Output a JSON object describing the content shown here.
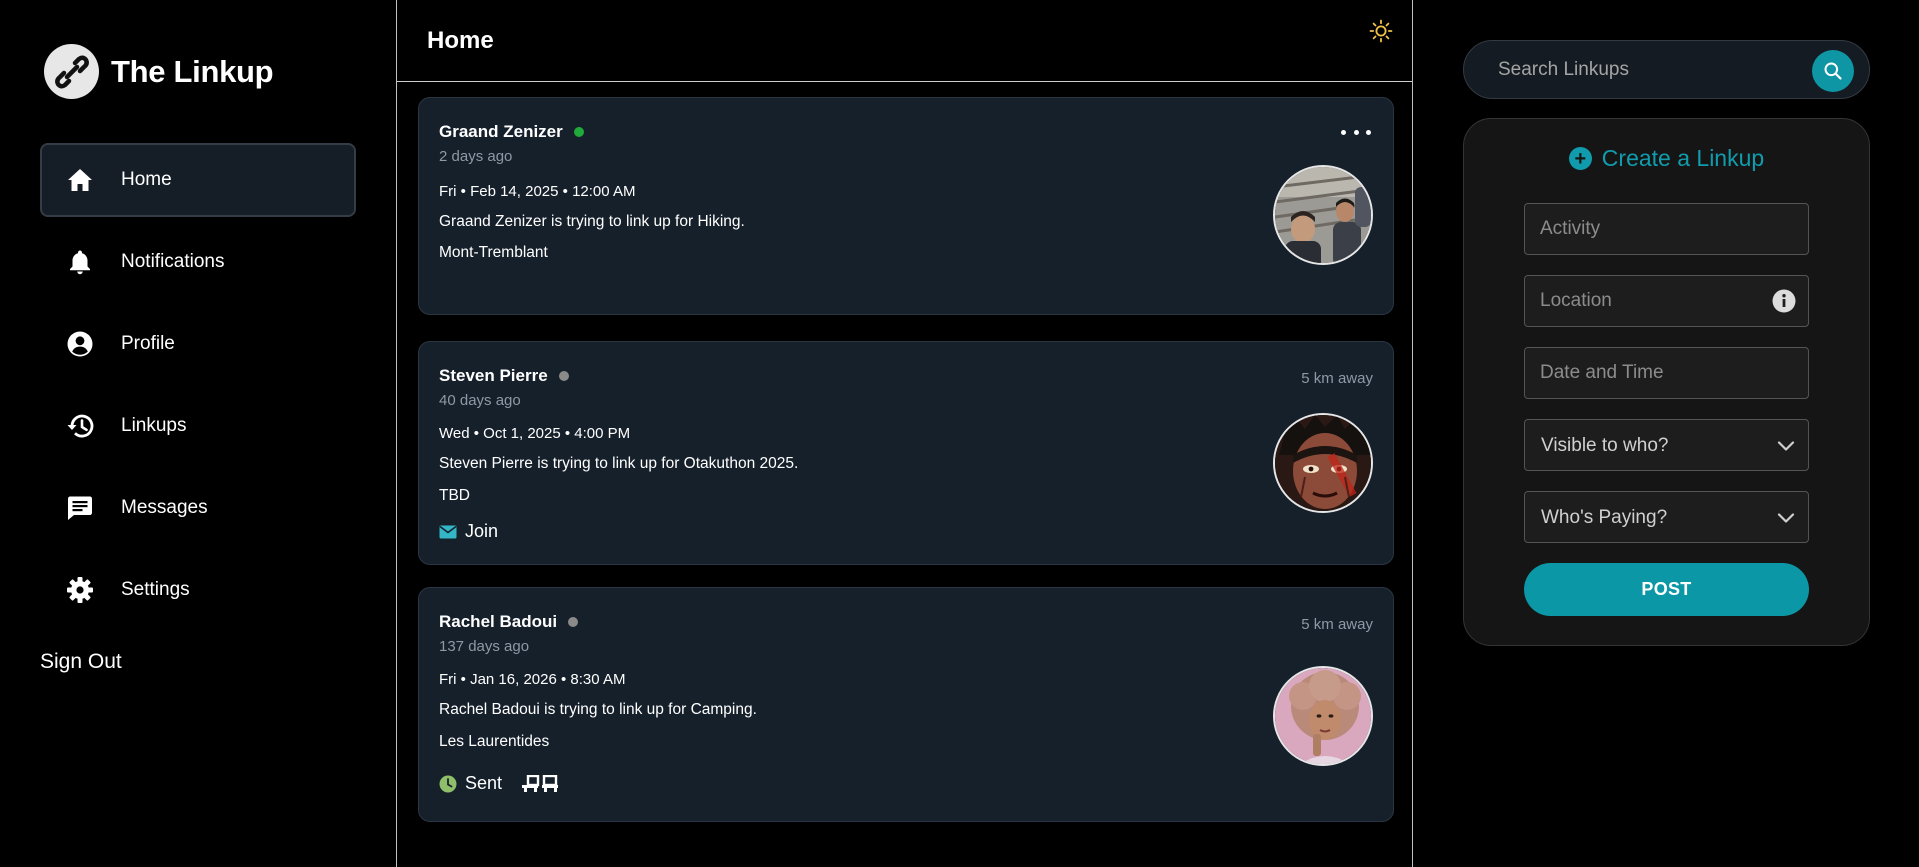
{
  "brand": {
    "name": "The Linkup"
  },
  "nav": {
    "items": [
      {
        "label": "Home",
        "icon": "home-icon",
        "active": true
      },
      {
        "label": "Notifications",
        "icon": "bell-icon"
      },
      {
        "label": "Profile",
        "icon": "profile-icon"
      },
      {
        "label": "Linkups",
        "icon": "history-icon"
      },
      {
        "label": "Messages",
        "icon": "message-icon"
      },
      {
        "label": "Settings",
        "icon": "gear-icon"
      }
    ],
    "sign_out": "Sign Out"
  },
  "feed": {
    "title": "Home",
    "posts": [
      {
        "author": "Graand Zenizer",
        "status_color": "#1faa3a",
        "ago": "2 days ago",
        "date": "Fri • Feb 14, 2025 • 12:00 AM",
        "description": "Graand Zenizer is trying to link up for Hiking.",
        "location": "Mont-Tremblant"
      },
      {
        "author": "Steven Pierre",
        "status_color": "#8a8a8a",
        "ago": "40 days ago",
        "distance": "5 km away",
        "date": "Wed • Oct 1, 2025 • 4:00 PM",
        "description": "Steven Pierre is trying to link up for Otakuthon 2025.",
        "location": "TBD",
        "action": "Join"
      },
      {
        "author": "Rachel Badoui",
        "status_color": "#8a8a8a",
        "ago": "137 days ago",
        "distance": "5 km away",
        "date": "Fri • Jan 16, 2026 • 8:30 AM",
        "description": "Rachel Badoui is trying to link up for Camping.",
        "location": "Les Laurentides",
        "action": "Sent"
      }
    ]
  },
  "search": {
    "placeholder": "Search Linkups"
  },
  "create": {
    "title": "Create a Linkup",
    "activity_placeholder": "Activity",
    "location_placeholder": "Location",
    "datetime_placeholder": "Date and Time",
    "visibility_label": "Visible to who?",
    "payer_label": "Who's Paying?",
    "post_label": "POST"
  },
  "colors": {
    "accent": "#119cad",
    "card": "#16202b",
    "online": "#1faa3a"
  }
}
